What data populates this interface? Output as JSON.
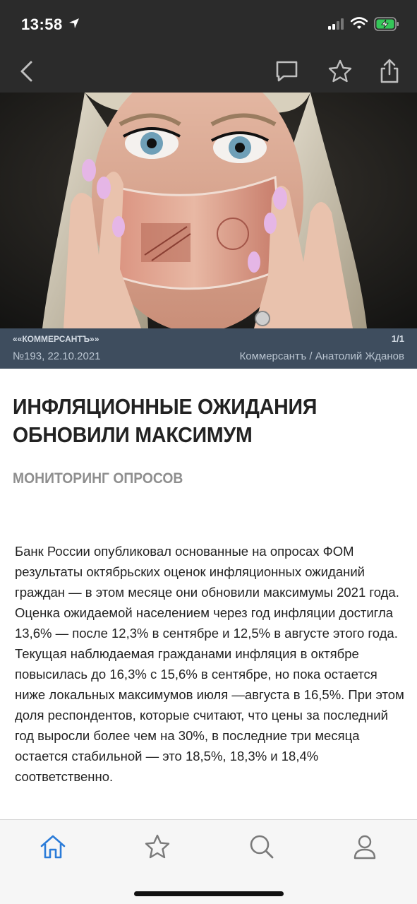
{
  "status_bar": {
    "time": "13:58"
  },
  "nav": {
    "icons": [
      "back-chevron-icon",
      "comment-icon",
      "star-icon",
      "share-icon"
    ]
  },
  "photo": {
    "source": "««КОММЕРСАНТЪ»»",
    "counter": "1/1",
    "issue": "№193, 22.10.2021",
    "credit": "Коммерсантъ / Анатолий Жданов"
  },
  "article": {
    "headline": "ИНФЛЯЦИОННЫЕ ОЖИДАНИЯ ОБНОВИЛИ МАКСИМУМ",
    "rubric": "МОНИТОРИНГ ОПРОСОВ",
    "lead": "Банк России опубликовал основанные на опросах ФОМ результаты октябрьских оценок инфляционных ожиданий граждан — в этом месяце они обновили максимумы 2021 года. Оценка ожидаемой населением через год инфляции достигла 13,6% — после 12,3% в сентябре и 12,5% в августе этого года. Текущая наблюдаемая гражданами инфляция в октябре повысилась до 16,3% с 15,6% в сентябре, но пока остается ниже локальных максимумов июля —августа в 16,5%. При этом доля респондентов, которые считают, что цены за последний год выросли более чем на 30%, в последние три месяца остается стабильной — это 18,5%, 18,3% и 18,4% соответственно."
  },
  "tab_bar": {
    "icons": [
      "home-icon",
      "favorites-star-icon",
      "search-icon",
      "profile-icon"
    ],
    "active_color": "#2a7bd8"
  }
}
